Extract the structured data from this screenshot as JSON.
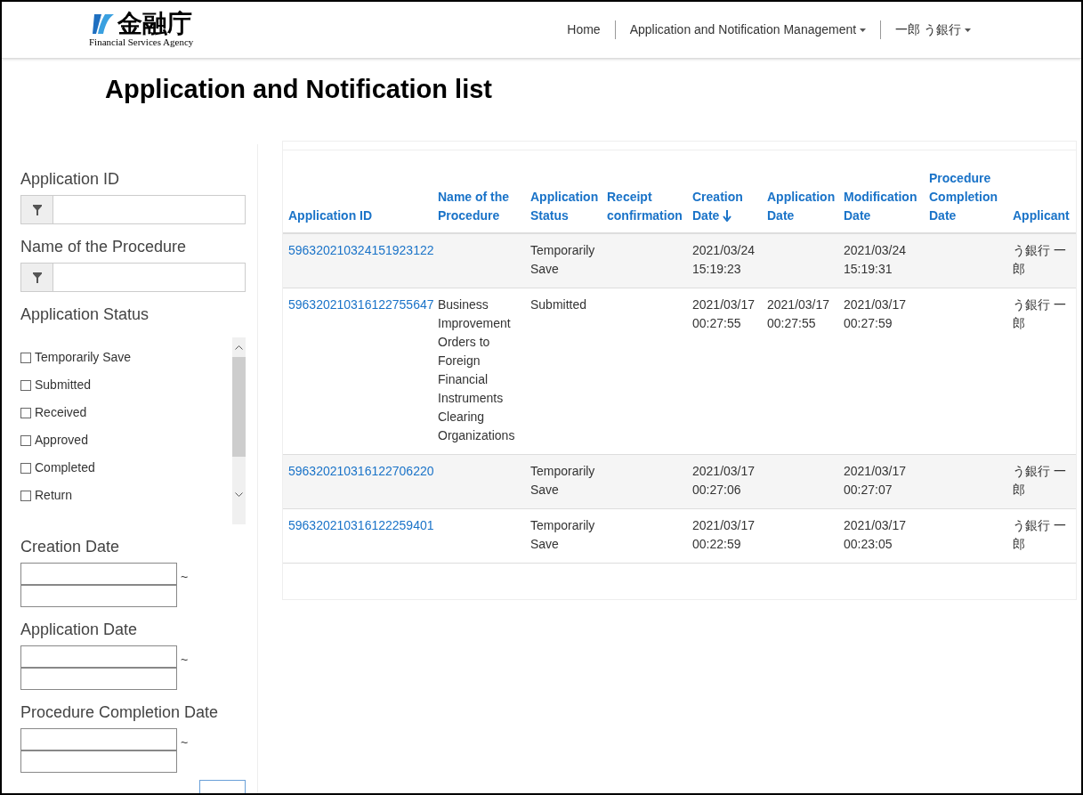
{
  "header": {
    "logo": {
      "name": "金融庁",
      "subtitle": "Financial Services Agency"
    },
    "nav": [
      {
        "label": "Home",
        "dropdown": false
      },
      {
        "label": "Application and Notification Management",
        "dropdown": true
      },
      {
        "label": "一郎 う銀行",
        "dropdown": true
      }
    ]
  },
  "page_title": "Application and Notification list",
  "filters": {
    "text_filters": [
      {
        "label": "Application ID"
      },
      {
        "label": "Name of the Procedure"
      }
    ],
    "status": {
      "label": "Application Status",
      "options": [
        {
          "label": "Temporarily Save",
          "checked": false
        },
        {
          "label": "Submitted",
          "checked": false
        },
        {
          "label": "Received",
          "checked": false
        },
        {
          "label": "Approved",
          "checked": false
        },
        {
          "label": "Completed",
          "checked": false
        },
        {
          "label": "Return",
          "checked": false
        }
      ]
    },
    "date_filters": [
      {
        "label": "Creation Date",
        "separator": "~"
      },
      {
        "label": "Application Date",
        "separator": "~"
      },
      {
        "label": "Procedure Completion Date",
        "separator": "~"
      }
    ]
  },
  "table": {
    "columns": [
      {
        "label": "Application ID",
        "sorted_desc": false
      },
      {
        "label": "Name of the Procedure",
        "sorted_desc": false
      },
      {
        "label": "Application Status",
        "sorted_desc": false
      },
      {
        "label": "Receipt confirmation",
        "sorted_desc": false
      },
      {
        "label": "Creation Date",
        "sorted_desc": true
      },
      {
        "label": "Application Date",
        "sorted_desc": false
      },
      {
        "label": "Modification Date",
        "sorted_desc": false
      },
      {
        "label": "Procedure Completion Date",
        "sorted_desc": false
      },
      {
        "label": "Applicant",
        "sorted_desc": false
      }
    ],
    "rows": [
      {
        "id": "596320210324151923122",
        "procedure": "",
        "status": "Temporarily Save",
        "receipt": "",
        "created": "2021/03/24 15:19:23",
        "applied": "",
        "modified": "2021/03/24 15:19:31",
        "completed": "",
        "applicant": "う銀行 一郎"
      },
      {
        "id": "596320210316122755647",
        "procedure": "Business Improvement Orders to Foreign Financial Instruments Clearing Organizations",
        "status": "Submitted",
        "receipt": "",
        "created": "2021/03/17 00:27:55",
        "applied": "2021/03/17 00:27:55",
        "modified": "2021/03/17 00:27:59",
        "completed": "",
        "applicant": "う銀行 一郎"
      },
      {
        "id": "596320210316122706220",
        "procedure": "",
        "status": "Temporarily Save",
        "receipt": "",
        "created": "2021/03/17 00:27:06",
        "applied": "",
        "modified": "2021/03/17 00:27:07",
        "completed": "",
        "applicant": "う銀行 一郎"
      },
      {
        "id": "596320210316122259401",
        "procedure": "",
        "status": "Temporarily Save",
        "receipt": "",
        "created": "2021/03/17 00:22:59",
        "applied": "",
        "modified": "2021/03/17 00:23:05",
        "completed": "",
        "applicant": "う銀行 一郎"
      }
    ]
  }
}
